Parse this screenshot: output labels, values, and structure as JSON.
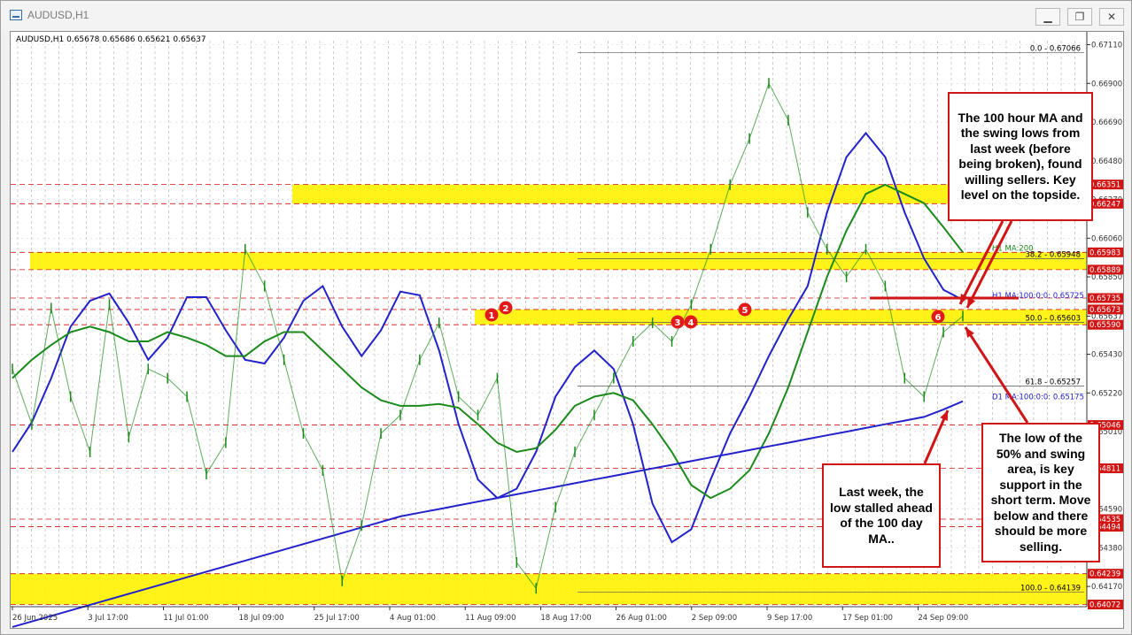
{
  "window": {
    "title": "AUDUSD,H1"
  },
  "window_controls": {
    "minimize": "▁",
    "restore": "❐",
    "close": "✕"
  },
  "chart_header": "AUDUSD,H1  0.65678 0.65686 0.65621 0.65637",
  "annotations": {
    "ma_sellers": "The 100 hour MA and the swing lows from last week (before being broken), found willing sellers. Key level on the topside.",
    "day_ma_stall": "Last week, the low stalled ahead of the 100 day MA..",
    "fifty_support": "The low of the 50% and swing area, is key support in the short term. Move below and there should be more selling."
  },
  "chart_data": {
    "type": "candlestick",
    "symbol": "AUDUSD",
    "timeframe": "H1",
    "ohlc_current": {
      "open": 0.65678,
      "high": 0.65686,
      "low": 0.65621,
      "close": 0.65637
    },
    "ylim": [
      0.6406,
      0.6717
    ],
    "y_ticks": [
      {
        "label": "0.67110",
        "value": 0.6711
      },
      {
        "label": "0.66900",
        "value": 0.669
      },
      {
        "label": "0.66690",
        "value": 0.6669
      },
      {
        "label": "0.66480",
        "value": 0.6648
      },
      {
        "label": "0.66270",
        "value": 0.6627
      },
      {
        "label": "0.66060",
        "value": 0.6606
      },
      {
        "label": "0.65850",
        "value": 0.6585
      },
      {
        "label": "0.65637",
        "value": 0.65637
      },
      {
        "label": "0.65430",
        "value": 0.6543
      },
      {
        "label": "0.65220",
        "value": 0.6522
      },
      {
        "label": "0.65010",
        "value": 0.6501
      },
      {
        "label": "0.64800",
        "value": 0.648
      },
      {
        "label": "0.64590",
        "value": 0.6459
      },
      {
        "label": "0.64380",
        "value": 0.6438
      },
      {
        "label": "0.64170",
        "value": 0.6417
      }
    ],
    "x_ticks": [
      "26 Jun 2025",
      "3 Jul 17:00",
      "11 Jul 01:00",
      "18 Jul 09:00",
      "25 Jul 17:00",
      "4 Aug 01:00",
      "11 Aug 09:00",
      "18 Aug 17:00",
      "26 Aug 01:00",
      "2 Sep 09:00",
      "9 Sep 17:00",
      "17 Sep 01:00",
      "24 Sep 09:00"
    ],
    "price_levels": [
      {
        "label": "0.66351",
        "value": 0.66351,
        "color": "#d11414"
      },
      {
        "label": "0.66247",
        "value": 0.66247,
        "color": "#d11414"
      },
      {
        "label": "0.65983",
        "value": 0.65983,
        "color": "#d11414"
      },
      {
        "label": "0.65889",
        "value": 0.65889,
        "color": "#d11414"
      },
      {
        "label": "0.65735",
        "value": 0.65735,
        "color": "#d11414"
      },
      {
        "label": "0.65673",
        "value": 0.65673,
        "color": "#d11414"
      },
      {
        "label": "0.65590",
        "value": 0.6559,
        "color": "#d11414"
      },
      {
        "label": "0.65046",
        "value": 0.65046,
        "color": "#d11414"
      },
      {
        "label": "0.64811",
        "value": 0.64811,
        "color": "#d11414"
      },
      {
        "label": "0.64535",
        "value": 0.64535,
        "color": "#d11414"
      },
      {
        "label": "0.64494",
        "value": 0.64494,
        "color": "#d11414"
      },
      {
        "label": "0.64239",
        "value": 0.64239,
        "color": "#d11414"
      },
      {
        "label": "0.64072",
        "value": 0.64072,
        "color": "#d11414"
      }
    ],
    "fib_levels": [
      {
        "label": "0.0 - 0.67066",
        "value": 0.67066
      },
      {
        "label": "38.2 - 0.65948",
        "value": 0.65948
      },
      {
        "label": "50.0 - 0.65603",
        "value": 0.65603
      },
      {
        "label": "61.8 - 0.65257",
        "value": 0.65257
      },
      {
        "label": "100.0 - 0.64139",
        "value": 0.64139
      }
    ],
    "ma_labels": [
      {
        "text": "H1 MA:100:0:0: 0.65725",
        "value": 0.65725,
        "color": "#2222cc"
      },
      {
        "text": "D1 MA:100:0:0: 0.65175",
        "value": 0.65175,
        "color": "#2222cc"
      },
      {
        "text": "H1 MA:200",
        "value": 0.65983,
        "color": "#1a8a1a"
      }
    ],
    "yellow_zones": [
      {
        "low": 0.66247,
        "high": 0.66351
      },
      {
        "low": 0.65889,
        "high": 0.65983
      },
      {
        "low": 0.6559,
        "high": 0.65673
      },
      {
        "low": 0.64072,
        "high": 0.64239
      }
    ],
    "markers": [
      "1",
      "2",
      "3",
      "4",
      "5",
      "6"
    ],
    "series": [
      {
        "name": "H1 MA 100",
        "color": "#2222cc",
        "values": [
          0.649,
          0.6506,
          0.653,
          0.6558,
          0.6572,
          0.6576,
          0.656,
          0.654,
          0.6552,
          0.6574,
          0.6574,
          0.6556,
          0.654,
          0.6538,
          0.6552,
          0.6572,
          0.658,
          0.6558,
          0.6542,
          0.6556,
          0.6577,
          0.6575,
          0.6545,
          0.6505,
          0.6475,
          0.6465,
          0.647,
          0.649,
          0.652,
          0.6536,
          0.6545,
          0.6535,
          0.6505,
          0.6462,
          0.6441,
          0.6448,
          0.6475,
          0.65,
          0.652,
          0.6542,
          0.6562,
          0.658,
          0.662,
          0.665,
          0.6663,
          0.665,
          0.662,
          0.6595,
          0.6578,
          0.65725
        ]
      },
      {
        "name": "H1 MA 200",
        "color": "#1a8a1a",
        "values": [
          0.653,
          0.654,
          0.6548,
          0.6555,
          0.6558,
          0.6555,
          0.655,
          0.655,
          0.6555,
          0.6552,
          0.6548,
          0.6542,
          0.6542,
          0.655,
          0.6555,
          0.6555,
          0.6545,
          0.6535,
          0.6525,
          0.6518,
          0.6515,
          0.6515,
          0.6516,
          0.6514,
          0.6505,
          0.6495,
          0.649,
          0.6492,
          0.6502,
          0.6515,
          0.652,
          0.6522,
          0.6518,
          0.6505,
          0.649,
          0.6472,
          0.6465,
          0.647,
          0.648,
          0.65,
          0.6525,
          0.6555,
          0.6585,
          0.661,
          0.663,
          0.6635,
          0.663,
          0.6625,
          0.6612,
          0.65983
        ]
      },
      {
        "name": "D1 MA 100",
        "color": "#2222cc",
        "values": [
          0.6395,
          0.6398,
          0.6401,
          0.6404,
          0.6407,
          0.641,
          0.6413,
          0.6416,
          0.6419,
          0.6422,
          0.6425,
          0.6428,
          0.6431,
          0.6434,
          0.6437,
          0.644,
          0.6443,
          0.6446,
          0.6449,
          0.6452,
          0.6455,
          0.6457,
          0.6459,
          0.6461,
          0.6463,
          0.6465,
          0.6467,
          0.6469,
          0.6471,
          0.6473,
          0.6475,
          0.6477,
          0.6479,
          0.6481,
          0.6483,
          0.6485,
          0.6487,
          0.6489,
          0.6491,
          0.6493,
          0.6495,
          0.6497,
          0.6499,
          0.6501,
          0.6503,
          0.6505,
          0.6507,
          0.6509,
          0.6513,
          0.65175
        ]
      },
      {
        "name": "Price",
        "color": "#1a8a1a",
        "values": [
          0.6535,
          0.6505,
          0.6568,
          0.652,
          0.649,
          0.657,
          0.6498,
          0.6535,
          0.653,
          0.652,
          0.6478,
          0.6495,
          0.66,
          0.658,
          0.654,
          0.65,
          0.648,
          0.642,
          0.645,
          0.65,
          0.651,
          0.654,
          0.656,
          0.652,
          0.651,
          0.653,
          0.643,
          0.6416,
          0.646,
          0.649,
          0.651,
          0.653,
          0.655,
          0.656,
          0.655,
          0.657,
          0.66,
          0.6635,
          0.666,
          0.669,
          0.667,
          0.662,
          0.66,
          0.6585,
          0.66,
          0.658,
          0.653,
          0.652,
          0.6555,
          0.65637
        ]
      }
    ]
  }
}
